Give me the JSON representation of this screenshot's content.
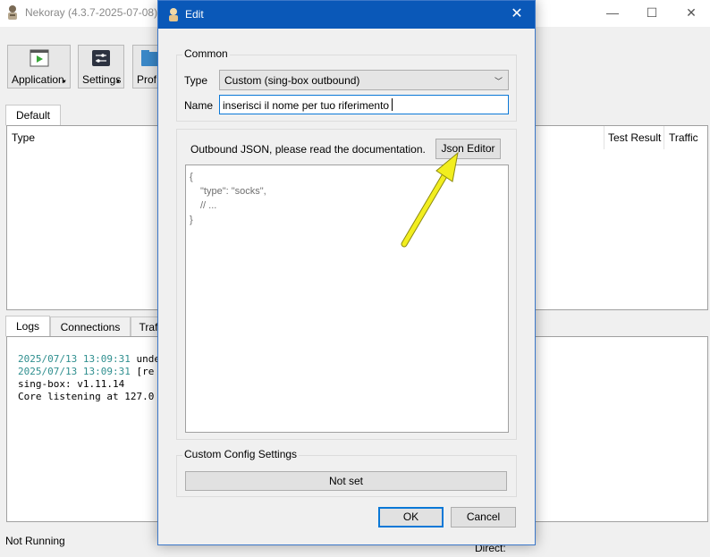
{
  "main_window": {
    "title": "Nekoray (4.3.7-2025-07-08)",
    "controls": {
      "minimize": "—",
      "maximize": "☐",
      "close": "✕"
    },
    "toolbar": [
      {
        "label": "Application",
        "icon": "application-icon"
      },
      {
        "label": "Settings",
        "icon": "settings-icon"
      },
      {
        "label": "Prof",
        "icon": "profiles-icon"
      }
    ],
    "group_tab": "Default",
    "table_headers": {
      "type": "Type",
      "test_result": "Test Result",
      "traffic": "Traffic"
    },
    "bottom_tabs": [
      "Logs",
      "Connections",
      "Traf"
    ],
    "logs": [
      {
        "timestamp": "2025/07/13 13:09:31",
        "text": " unde"
      },
      {
        "timestamp": "2025/07/13 13:09:31",
        "text": " [re"
      },
      {
        "timestamp": "",
        "text": "sing-box: v1.11.14"
      },
      {
        "timestamp": "",
        "text": "Core listening at 127.0"
      }
    ],
    "status_left": "Not Running",
    "status_right": "Direct:"
  },
  "dialog": {
    "title": "Edit",
    "close": "✕",
    "common": {
      "group_title": "Common",
      "type_label": "Type",
      "type_value": "Custom (sing-box outbound)",
      "name_label": "Name",
      "name_value": "inserisci il nome per tuo riferimento"
    },
    "outbound_hint": "Outbound JSON, please read the documentation.",
    "json_editor_button": "Json Editor",
    "json_placeholder": [
      "{",
      "\"type\": \"socks\",",
      "// ...",
      "}"
    ],
    "custom_config": {
      "group_title": "Custom Config Settings",
      "button": "Not set"
    },
    "ok": "OK",
    "cancel": "Cancel"
  },
  "colors": {
    "dialog_titlebar": "#0a58b8",
    "focus_border": "#0a78d7",
    "annotation_arrow": "#f2ee1f",
    "log_timestamp": "#2f8f8f"
  }
}
